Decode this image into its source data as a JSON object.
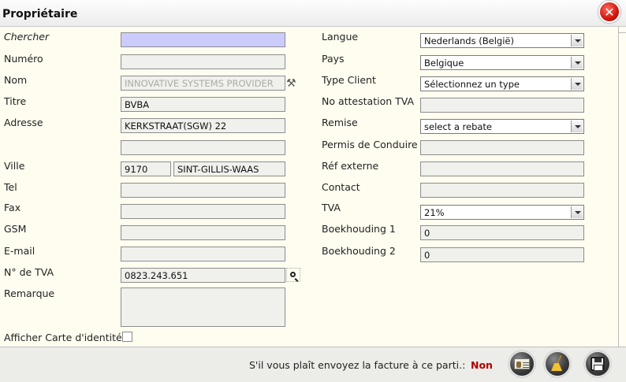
{
  "window": {
    "title": "Propriétaire"
  },
  "left": {
    "chercher": {
      "label": "Chercher",
      "value": ""
    },
    "numero": {
      "label": "Numéro",
      "value": ""
    },
    "nom": {
      "label": "Nom",
      "value": "INNOVATIVE SYSTEMS PROVIDER"
    },
    "titre": {
      "label": "Titre",
      "value": "BVBA"
    },
    "adresse": {
      "label": "Adresse",
      "value": "KERKSTRAAT(SGW) 22",
      "value2": ""
    },
    "ville": {
      "label": "Ville",
      "postcode": "9170",
      "city": "SINT-GILLIS-WAAS"
    },
    "tel": {
      "label": "Tel",
      "value": ""
    },
    "fax": {
      "label": "Fax",
      "value": ""
    },
    "gsm": {
      "label": "GSM",
      "value": ""
    },
    "email": {
      "label": "E-mail",
      "value": ""
    },
    "tva": {
      "label": "N° de TVA",
      "value": "0823.243.651"
    },
    "remarque": {
      "label": "Remarque",
      "value": ""
    },
    "carte": {
      "label": "Afficher Carte d'identité"
    }
  },
  "right": {
    "langue": {
      "label": "Langue",
      "value": "Nederlands (België)"
    },
    "pays": {
      "label": "Pays",
      "value": "Belgique"
    },
    "type_client": {
      "label": "Type Client",
      "value": "Sélectionnez un type"
    },
    "attestation": {
      "label": "No attestation TVA",
      "value": ""
    },
    "remise": {
      "label": "Remise",
      "value": "select a rebate"
    },
    "permis": {
      "label": "Permis de Conduire",
      "value": ""
    },
    "ref_externe": {
      "label": "Réf externe",
      "value": ""
    },
    "contact": {
      "label": "Contact",
      "value": ""
    },
    "tva_rate": {
      "label": "TVA",
      "value": "21%"
    },
    "boekhouding1": {
      "label": "Boekhouding 1",
      "value": "0"
    },
    "boekhouding2": {
      "label": "Boekhouding 2",
      "value": "0"
    }
  },
  "footer": {
    "question": "S'il vous plaît envoyez la facture à ce parti.:",
    "answer": "Non"
  },
  "icons": {
    "close": "close-icon",
    "tools": "tools-icon",
    "search": "magnifier-icon",
    "idcard": "id-card-icon",
    "broom": "broom-icon",
    "save": "floppy-disk-icon"
  }
}
